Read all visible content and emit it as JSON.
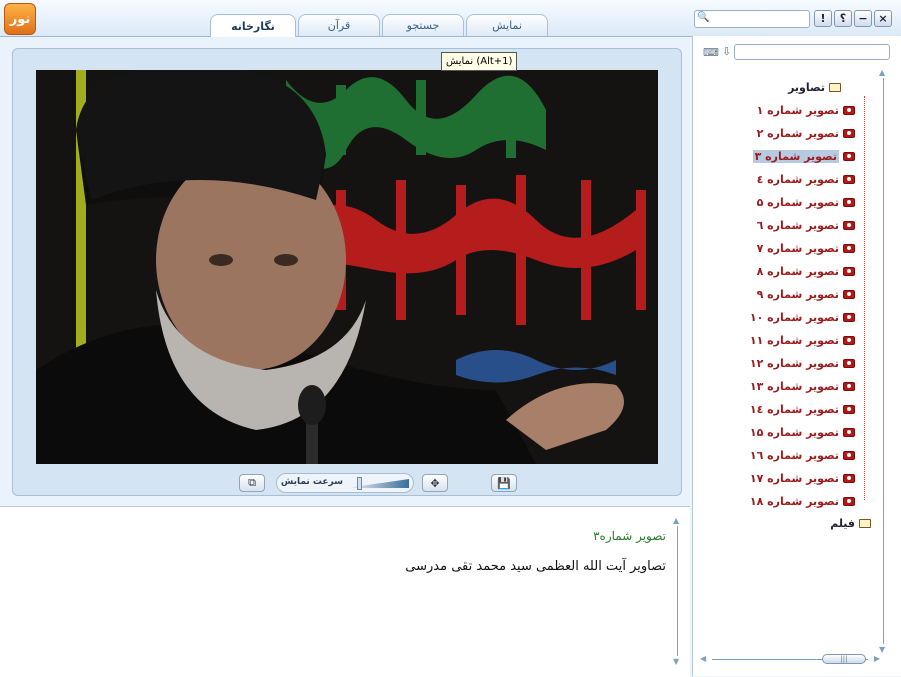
{
  "app": {
    "logo_text": "نور"
  },
  "tabs": [
    {
      "label": "نمایش",
      "active": false
    },
    {
      "label": "جستجو",
      "active": false
    },
    {
      "label": "قرآن",
      "active": false
    },
    {
      "label": "نگارخانه",
      "active": true
    }
  ],
  "top_search": {
    "placeholder": ""
  },
  "window_buttons": {
    "info": "!",
    "help": "؟",
    "minimize": "−",
    "close": "×"
  },
  "viewer": {
    "tooltip": "نمایش (Alt+1)",
    "speed_label": "سرعت نمایش",
    "speed_level": 0.2
  },
  "description": {
    "title": "تصویر شماره۳",
    "body": "تصاویر آیت الله العظمی سید محمد تقی مدرسی"
  },
  "sidebar": {
    "search_placeholder": "",
    "root_folder": "تصاویر",
    "items": [
      "تصویر شماره ۱",
      "تصویر شماره ۲",
      "تصویر شماره ۳",
      "تصویر شماره ٤",
      "تصویر شماره ۵",
      "تصویر شماره ٦",
      "تصویر شماره ۷",
      "تصویر شماره ۸",
      "تصویر شماره ۹",
      "تصویر شماره ۱۰",
      "تصویر شماره ۱۱",
      "تصویر شماره ۱۲",
      "تصویر شماره ۱۳",
      "تصویر شماره ۱٤",
      "تصویر شماره ۱۵",
      "تصویر شماره ۱٦",
      "تصویر شماره ۱۷",
      "تصویر شماره ۱۸"
    ],
    "selected_index": 2,
    "second_folder": "فیلم"
  },
  "colors": {
    "item_text": "#9b1b1b",
    "selected_bg": "#b6cbe2",
    "desc_title": "#2d7a2d"
  }
}
